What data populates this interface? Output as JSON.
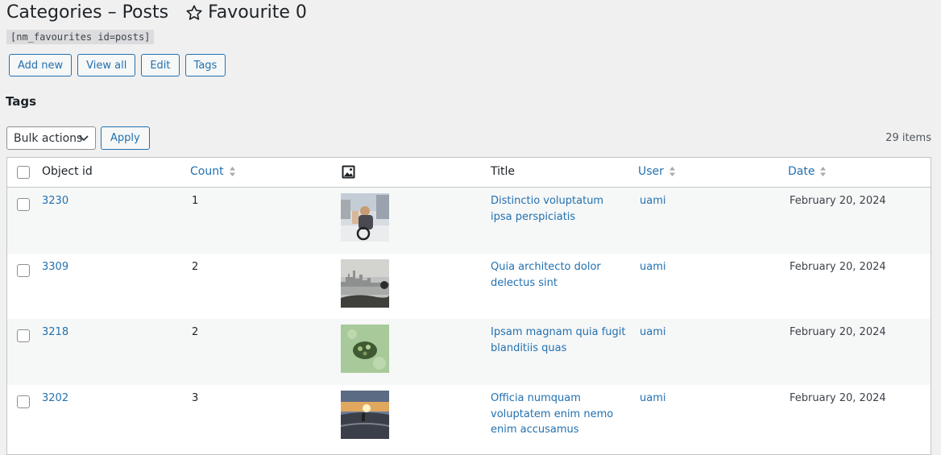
{
  "page": {
    "title": "Categories – Posts",
    "favourite_label": "Favourite 0",
    "shortcode": "[nm_favourites id=posts]"
  },
  "actions": {
    "add_new": "Add new",
    "view_all": "View all",
    "edit": "Edit",
    "tags": "Tags"
  },
  "section_title": "Tags",
  "bulk": {
    "selected": "Bulk actions",
    "apply": "Apply"
  },
  "items_count": "29 items",
  "columns": {
    "object_id": "Object id",
    "count": "Count",
    "image_icon": "image-icon",
    "title": "Title",
    "user": "User",
    "date": "Date"
  },
  "rows": [
    {
      "id": "3230",
      "count": "1",
      "title": "Distinctio voluptatum ipsa perspiciatis",
      "user": "uami",
      "date": "February 20, 2024",
      "thumb": "city-street-photo"
    },
    {
      "id": "3309",
      "count": "2",
      "title": "Quia architecto dolor delectus sint",
      "user": "uami",
      "date": "February 20, 2024",
      "thumb": "skyline-photo"
    },
    {
      "id": "3218",
      "count": "2",
      "title": "Ipsam magnam quia fugit blanditiis quas",
      "user": "uami",
      "date": "February 20, 2024",
      "thumb": "green-object-photo"
    },
    {
      "id": "3202",
      "count": "3",
      "title": "Officia numquam voluptatem enim nemo enim accusamus",
      "user": "uami",
      "date": "February 20, 2024",
      "thumb": "sunset-photo"
    }
  ],
  "colors": {
    "link": "#2271b1",
    "text": "#1d2327",
    "background": "#f0f0f1"
  }
}
